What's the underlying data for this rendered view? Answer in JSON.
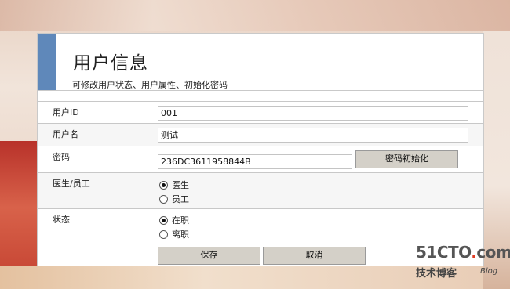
{
  "header": {
    "title": "用户信息",
    "subtitle": "可修改用户状态、用户属性、初始化密码",
    "accent_color": "#5f88ba"
  },
  "form": {
    "user_id": {
      "label": "用户ID",
      "value": "001"
    },
    "username": {
      "label": "用户名",
      "value": "测试"
    },
    "password": {
      "label": "密码",
      "value": "236DC3611958844B",
      "reset_button": "密码初始化"
    },
    "role": {
      "label": "医生/员工",
      "options": [
        {
          "label": "医生",
          "selected": true
        },
        {
          "label": "员工",
          "selected": false
        }
      ]
    },
    "status": {
      "label": "状态",
      "options": [
        {
          "label": "在职",
          "selected": true
        },
        {
          "label": "离职",
          "selected": false
        }
      ]
    }
  },
  "actions": {
    "save_label": "保存",
    "cancel_label": "取消"
  },
  "watermark": {
    "site_prefix": "51CTO",
    "site_suffix": "com",
    "blog_cn": "技术博客",
    "blog_en": "Blog"
  }
}
